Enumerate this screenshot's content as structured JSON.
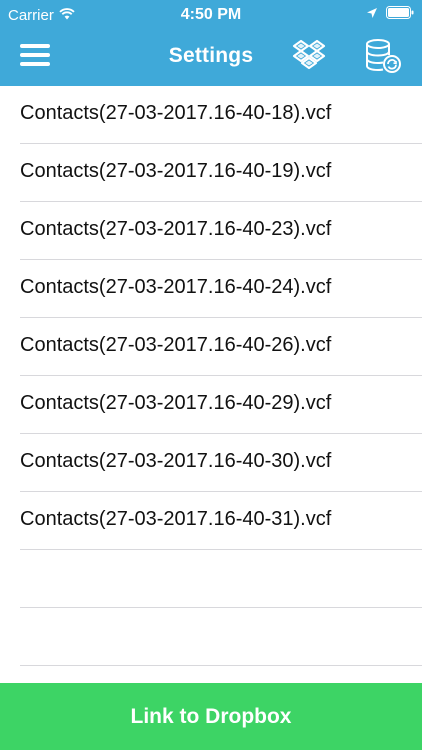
{
  "status_bar": {
    "carrier": "Carrier",
    "time": "4:50 PM",
    "icons": [
      "wifi-icon",
      "location-arrow-icon",
      "battery-icon"
    ]
  },
  "nav": {
    "title": "Settings",
    "icons": [
      "hamburger-menu-icon",
      "dropbox-icon",
      "database-sync-icon"
    ]
  },
  "files": [
    "Contacts(27-03-2017.16-40-18).vcf",
    "Contacts(27-03-2017.16-40-19).vcf",
    "Contacts(27-03-2017.16-40-23).vcf",
    "Contacts(27-03-2017.16-40-24).vcf",
    "Contacts(27-03-2017.16-40-26).vcf",
    "Contacts(27-03-2017.16-40-29).vcf",
    "Contacts(27-03-2017.16-40-30).vcf",
    "Contacts(27-03-2017.16-40-31).vcf"
  ],
  "footer": {
    "link_label": "Link to Dropbox"
  },
  "colors": {
    "header": "#3fa9d9",
    "footer_button": "#3dd465",
    "text": "#111111",
    "separator": "#d8d8dc"
  }
}
